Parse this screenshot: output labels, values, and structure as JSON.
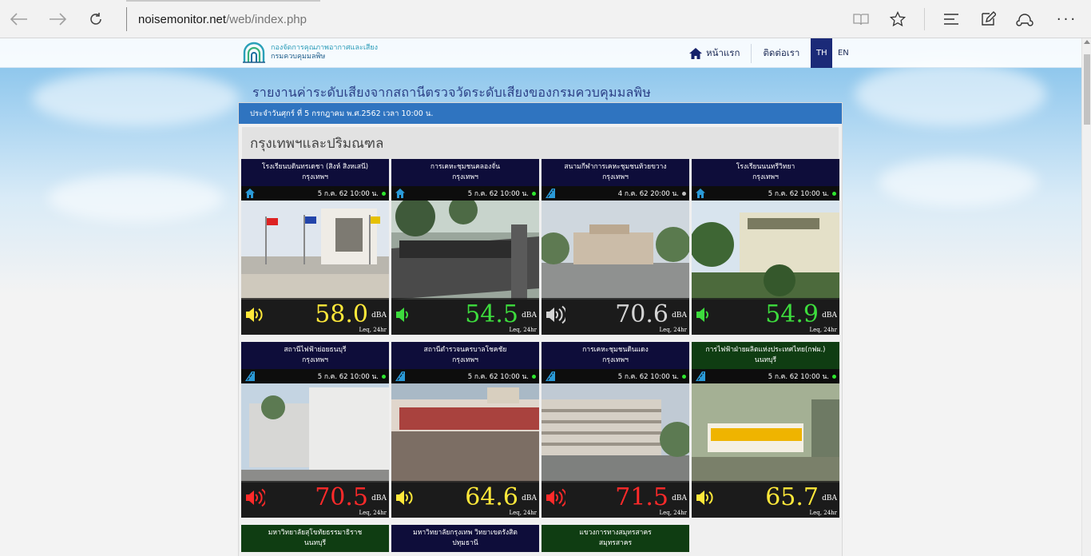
{
  "browser": {
    "url_host": "noisemonitor.net",
    "url_path": "/web/index.php"
  },
  "site": {
    "logo_line1": "กองจัดการคุณภาพอากาศและเสียง",
    "logo_line2": "กรมควบคุมมลพิษ",
    "menu_home": "หน้าแรก",
    "menu_contact": "ติดต่อเรา",
    "lang_th": "TH",
    "lang_en": "EN"
  },
  "report": {
    "title": "รายงานค่าระดับเสียงจากสถานีตรวจวัดระดับเสียงของกรมควบคุมมลพิษ",
    "date_line": "ประจำวันศุกร์ ที่ 5 กรกฎาคม พ.ศ.2562 เวลา 10:00 น.",
    "region": "กรุงเทพฯและปริมณฑล"
  },
  "common": {
    "unit": "dBA",
    "leq": "Leq, 24hr"
  },
  "colors": {
    "yellow": "#ffe83a",
    "green": "#3ddc3d",
    "gray": "#d4d4d4",
    "red": "#ff2a2a"
  },
  "stations": [
    {
      "name": "โรงเรียนบดินทรเดชา (สิงห์ สิงหเสนี)",
      "province": "กรุงเทพฯ",
      "time": "5 ก.ค. 62 10:00 น.",
      "value": "58.0",
      "level": "yellow",
      "station_icon": "home-icon",
      "status": "green"
    },
    {
      "name": "การเคหะชุมชนคลองจั่น",
      "province": "กรุงเทพฯ",
      "time": "5 ก.ค. 62 10:00 น.",
      "value": "54.5",
      "level": "green",
      "station_icon": "home-icon",
      "status": "green"
    },
    {
      "name": "สนามกีฬาการเคหะชุมชนห้วยขวาง",
      "province": "กรุงเทพฯ",
      "time": "4 ก.ค. 62 20:00 น.",
      "value": "70.6",
      "level": "gray",
      "station_icon": "road-icon",
      "status": "gray"
    },
    {
      "name": "โรงเรียนนนทรีวิทยา",
      "province": "กรุงเทพฯ",
      "time": "5 ก.ค. 62 10:00 น.",
      "value": "54.9",
      "level": "green",
      "station_icon": "home-icon",
      "status": "green"
    },
    {
      "name": "สถานีไฟฟ้าย่อยธนบุรี",
      "province": "กรุงเทพฯ",
      "time": "5 ก.ค. 62 10:00 น.",
      "value": "70.5",
      "level": "red",
      "station_icon": "road-icon",
      "status": "green"
    },
    {
      "name": "สถานีตำรวจนครบาลโชคชัย",
      "province": "กรุงเทพฯ",
      "time": "5 ก.ค. 62 10:00 น.",
      "value": "64.6",
      "level": "yellow",
      "station_icon": "road-icon",
      "status": "green"
    },
    {
      "name": "การเคหะชุมชนดินแดง",
      "province": "กรุงเทพฯ",
      "time": "5 ก.ค. 62 10:00 น.",
      "value": "71.5",
      "level": "red",
      "station_icon": "road-icon",
      "status": "green"
    },
    {
      "name": "การไฟฟ้าฝ่ายผลิตแห่งประเทศไทย(กฟผ.)",
      "province": "นนทบุรี",
      "time": "5 ก.ค. 62 10:00 น.",
      "value": "65.7",
      "level": "yellow",
      "station_icon": "road-icon",
      "status": "green"
    }
  ],
  "partial_stations": [
    {
      "name": "มหาวิทยาลัยสุโขทัยธรรมาธิราช",
      "province": "นนทบุรี"
    },
    {
      "name": "มหาวิทยาลัยกรุงเทพ วิทยาเขตรังสิต",
      "province": "ปทุมธานี"
    },
    {
      "name": "แขวงการทางสมุทรสาคร",
      "province": "สมุทรสาคร"
    }
  ]
}
